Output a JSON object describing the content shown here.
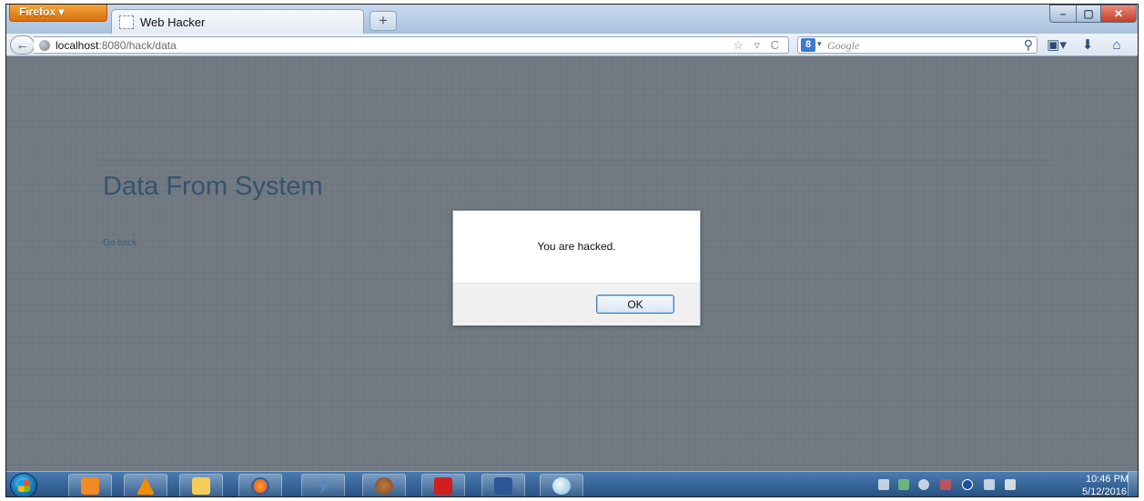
{
  "browser": {
    "menu_button_label": "Firefox ▾",
    "tab_title": "Web Hacker",
    "new_tab_label": "+",
    "window_controls": {
      "minimize": "–",
      "maximize": "▢",
      "close": "✕"
    }
  },
  "navbar": {
    "back_label": "←",
    "url_host": "localhost",
    "url_rest": ":8080/hack/data",
    "url_actions": "☆ ▿ C",
    "search_engine_badge": "8",
    "search_engine_arrow": "▾",
    "search_placeholder": "Google",
    "search_go_label": "⚲",
    "bookmarks_label": "▣▾",
    "downloads_label": "⬇",
    "home_label": "⌂"
  },
  "page": {
    "heading": "Data From System",
    "go_back_link": "Go back"
  },
  "alert": {
    "message": "You are hacked.",
    "ok_label": "OK"
  },
  "taskbar": {
    "pinned_apps": [
      {
        "name": "outlook",
        "color": "#f08a24"
      },
      {
        "name": "vlc",
        "color": "#f28c00"
      },
      {
        "name": "explorer",
        "color": "#f3cd5a"
      },
      {
        "name": "firefox",
        "color": "#e8671c"
      },
      {
        "name": "winamp",
        "color": "#5a86c6"
      },
      {
        "name": "settings-app",
        "color": "#7a4b2a"
      },
      {
        "name": "adobe-reader",
        "color": "#d11f1f"
      },
      {
        "name": "word",
        "color": "#2b5797"
      },
      {
        "name": "paint",
        "color": "#7ec2e8"
      }
    ],
    "clock_time": "10:46 PM",
    "clock_date": "5/12/2016"
  },
  "colors": {
    "overlay": "#727a83",
    "heading": "#36536d",
    "ok_button_border": "#3c7fb1",
    "firefox_button": "#e58b22"
  }
}
